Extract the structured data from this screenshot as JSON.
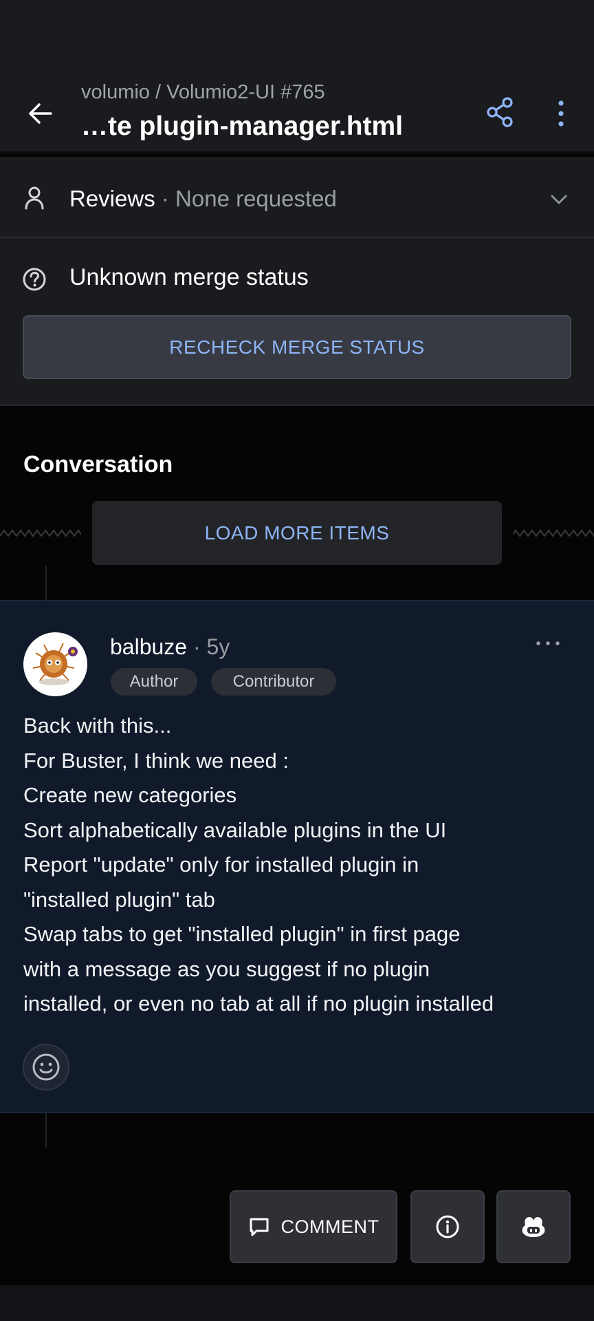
{
  "header": {
    "repo_path": "volumio / Volumio2-UI #765",
    "title": "…te plugin-manager.html",
    "icons": [
      "back-arrow-icon",
      "share-icon",
      "more-vert-icon"
    ]
  },
  "reviews": {
    "label": "Reviews",
    "separator": " · ",
    "value": "None requested"
  },
  "merge": {
    "status_text": "Unknown merge status",
    "recheck_label": "RECHECK MERGE STATUS"
  },
  "conversation": {
    "heading": "Conversation",
    "load_more_label": "LOAD MORE ITEMS"
  },
  "comment": {
    "author": "balbuze",
    "time": " · 5y",
    "badges": [
      "Author",
      "Contributor"
    ],
    "body_lines": [
      "Back with this...",
      "For Buster, I think we need :",
      "Create new categories",
      "Sort alphabetically available plugins in the UI",
      "Report \"update\" only for installed plugin in",
      "\"installed plugin\" tab",
      "Swap tabs to get \"installed plugin\" in first page",
      "with a message as you suggest if no plugin",
      "installed, or even no tab at all if no plugin installed"
    ]
  },
  "actions": {
    "comment_label": "COMMENT"
  },
  "colors": {
    "surface": "#1a1b1f",
    "background": "#050505",
    "accent": "#8eb5f7",
    "comment_card": "#111a2b",
    "button": "#2e3036"
  }
}
